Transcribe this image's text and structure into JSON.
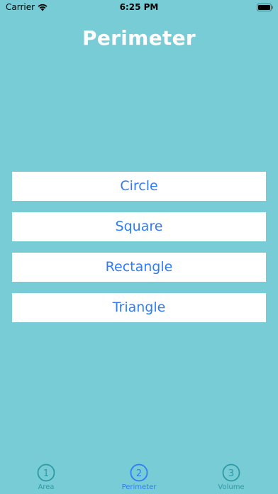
{
  "status_bar": {
    "carrier": "Carrier",
    "time": "6:25 PM"
  },
  "title": "Perimeter",
  "shapes": [
    {
      "label": "Circle"
    },
    {
      "label": "Square"
    },
    {
      "label": "Rectangle"
    },
    {
      "label": "Triangle"
    }
  ],
  "tabs": [
    {
      "number": "1",
      "label": "Area",
      "active": false
    },
    {
      "number": "2",
      "label": "Perimeter",
      "active": true
    },
    {
      "number": "3",
      "label": "Volume",
      "active": false
    }
  ],
  "icons": {
    "status": [
      "wifi-icon",
      "battery-icon"
    ],
    "tabs": [
      "circled-number-1-icon",
      "circled-number-2-icon",
      "circled-number-3-icon"
    ]
  },
  "colors": {
    "background": "#77CCD5",
    "accent": "#2F7CF6",
    "tab_inactive": "#2E9AA5",
    "button_background": "#FFFFFF",
    "title": "#FFFFFF"
  }
}
